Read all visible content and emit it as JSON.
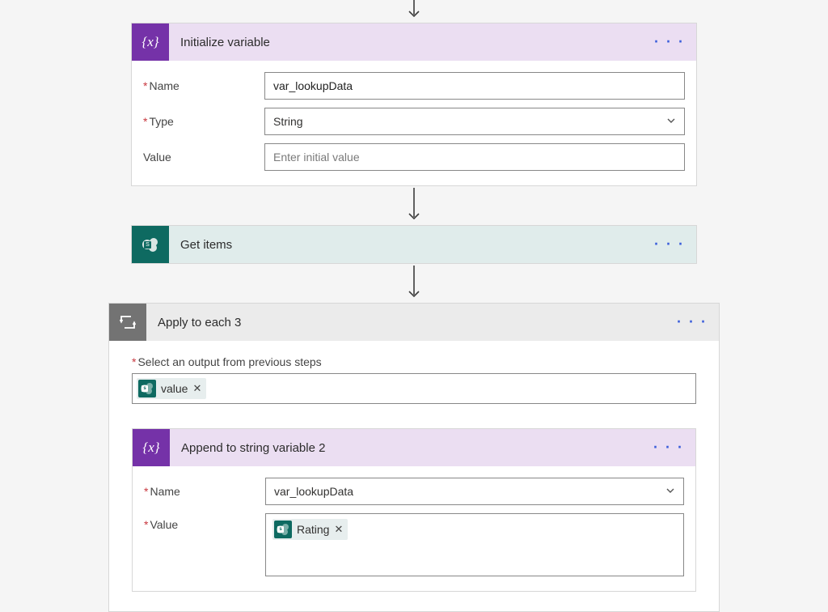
{
  "initVar": {
    "title": "Initialize variable",
    "nameLabel": "Name",
    "nameValue": "var_lookupData",
    "typeLabel": "Type",
    "typeValue": "String",
    "valueLabel": "Value",
    "valuePlaceholder": "Enter initial value"
  },
  "getItems": {
    "title": "Get items"
  },
  "applyEach": {
    "title": "Apply to each 3",
    "selectLabel": "Select an output from previous steps",
    "inputToken": "value"
  },
  "appendVar": {
    "title": "Append to string variable 2",
    "nameLabel": "Name",
    "nameValue": "var_lookupData",
    "valueLabel": "Value",
    "valueToken": "Rating"
  }
}
